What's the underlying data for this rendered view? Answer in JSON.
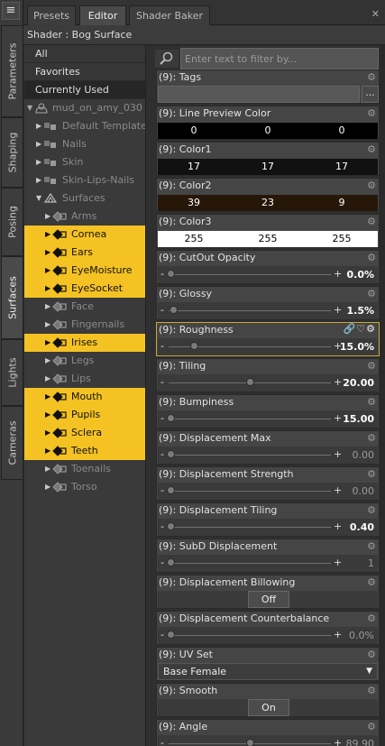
{
  "left_tabs": [
    {
      "label": "Parameters",
      "active": false
    },
    {
      "label": "Shaping",
      "active": false
    },
    {
      "label": "Posing",
      "active": false
    },
    {
      "label": "Surfaces",
      "active": true
    },
    {
      "label": "Lights",
      "active": false
    },
    {
      "label": "Cameras",
      "active": false
    }
  ],
  "top_tabs": [
    {
      "label": "Presets",
      "active": false
    },
    {
      "label": "Editor",
      "active": true
    },
    {
      "label": "Shader Baker",
      "active": false
    }
  ],
  "close_glyph": "✕",
  "shader_title": "Shader : Bog Surface",
  "filters": [
    "All",
    "Favorites",
    "Currently Used"
  ],
  "tree": {
    "root": "mud_on_amy_030",
    "groups": [
      "Default Templates",
      "Nails",
      "Skin",
      "Skin-Lips-Nails"
    ],
    "surfaces_label": "Surfaces",
    "items": [
      {
        "label": "Arms",
        "state": "dim"
      },
      {
        "label": "Cornea",
        "state": "selected"
      },
      {
        "label": "Ears",
        "state": "selected"
      },
      {
        "label": "EyeMoisture",
        "state": "selected"
      },
      {
        "label": "EyeSocket",
        "state": "selected"
      },
      {
        "label": "Face",
        "state": "dim"
      },
      {
        "label": "Fingernails",
        "state": "dim"
      },
      {
        "label": "Irises",
        "state": "selected"
      },
      {
        "label": "Legs",
        "state": "dim"
      },
      {
        "label": "Lips",
        "state": "dim"
      },
      {
        "label": "Mouth",
        "state": "selected"
      },
      {
        "label": "Pupils",
        "state": "selected"
      },
      {
        "label": "Sclera",
        "state": "selected"
      },
      {
        "label": "Teeth",
        "state": "selected"
      },
      {
        "label": "Toenails",
        "state": "dim"
      },
      {
        "label": "Torso",
        "state": "dim"
      }
    ]
  },
  "filter_placeholder": "Enter text to filter by...",
  "properties": {
    "tags": {
      "label": "(9): Tags",
      "button": "..."
    },
    "line_preview_color": {
      "label": "(9): Line Preview Color",
      "values": [
        "0",
        "0",
        "0"
      ],
      "swatch": "#000000",
      "text_color": "#ffffff"
    },
    "color1": {
      "label": "(9): Color1",
      "values": [
        "17",
        "17",
        "17"
      ],
      "swatch": "#111111",
      "text_color": "#ffffff"
    },
    "color2": {
      "label": "(9): Color2",
      "values": [
        "39",
        "23",
        "9"
      ],
      "swatch": "#271709",
      "text_color": "#ffffff"
    },
    "color3": {
      "label": "(9): Color3",
      "values": [
        "255",
        "255",
        "255"
      ],
      "swatch": "#ffffff",
      "text_color": "#000000"
    },
    "cutout_opacity": {
      "label": "(9): CutOut Opacity",
      "value": "0.0%",
      "fraction": 0.0,
      "bright": true
    },
    "glossy": {
      "label": "(9): Glossy",
      "value": "1.5%",
      "fraction": 0.015,
      "bright": true
    },
    "roughness": {
      "label": "(9): Roughness",
      "value": "15.0%",
      "fraction": 0.15,
      "bright": true
    },
    "tiling": {
      "label": "(9): Tiling",
      "value": "20.00",
      "fraction": 0.5,
      "bright": true
    },
    "bumpiness": {
      "label": "(9): Bumpiness",
      "value": "15.00",
      "fraction": 0.0,
      "bright": true
    },
    "displacement_max": {
      "label": "(9): Displacement Max",
      "value": "0.00",
      "fraction": 0.0,
      "bright": false
    },
    "displacement_strength": {
      "label": "(9): Displacement Strength",
      "value": "0.00",
      "fraction": 0.0,
      "bright": false
    },
    "displacement_tiling": {
      "label": "(9): Displacement Tiling",
      "value": "0.40",
      "fraction": 0.0,
      "bright": true
    },
    "subd_displacement": {
      "label": "(9): SubD Displacement",
      "value": "1",
      "fraction": 0.0,
      "bright": false
    },
    "displacement_billowing": {
      "label": "(9): Displacement Billowing",
      "button": "Off"
    },
    "displacement_counterbalance": {
      "label": "(9): Displacement Counterbalance",
      "value": "0.0%",
      "fraction": 0.0,
      "bright": false
    },
    "uv_set": {
      "label": "(9): UV Set",
      "value": "Base Female"
    },
    "smooth": {
      "label": "(9): Smooth",
      "button": "On"
    },
    "angle": {
      "label": "(9): Angle",
      "value": "89.90",
      "fraction": 0.5,
      "bright": false
    }
  },
  "icons": {
    "gear": "⚙",
    "roughness_extra": "🔗♡⚙"
  }
}
